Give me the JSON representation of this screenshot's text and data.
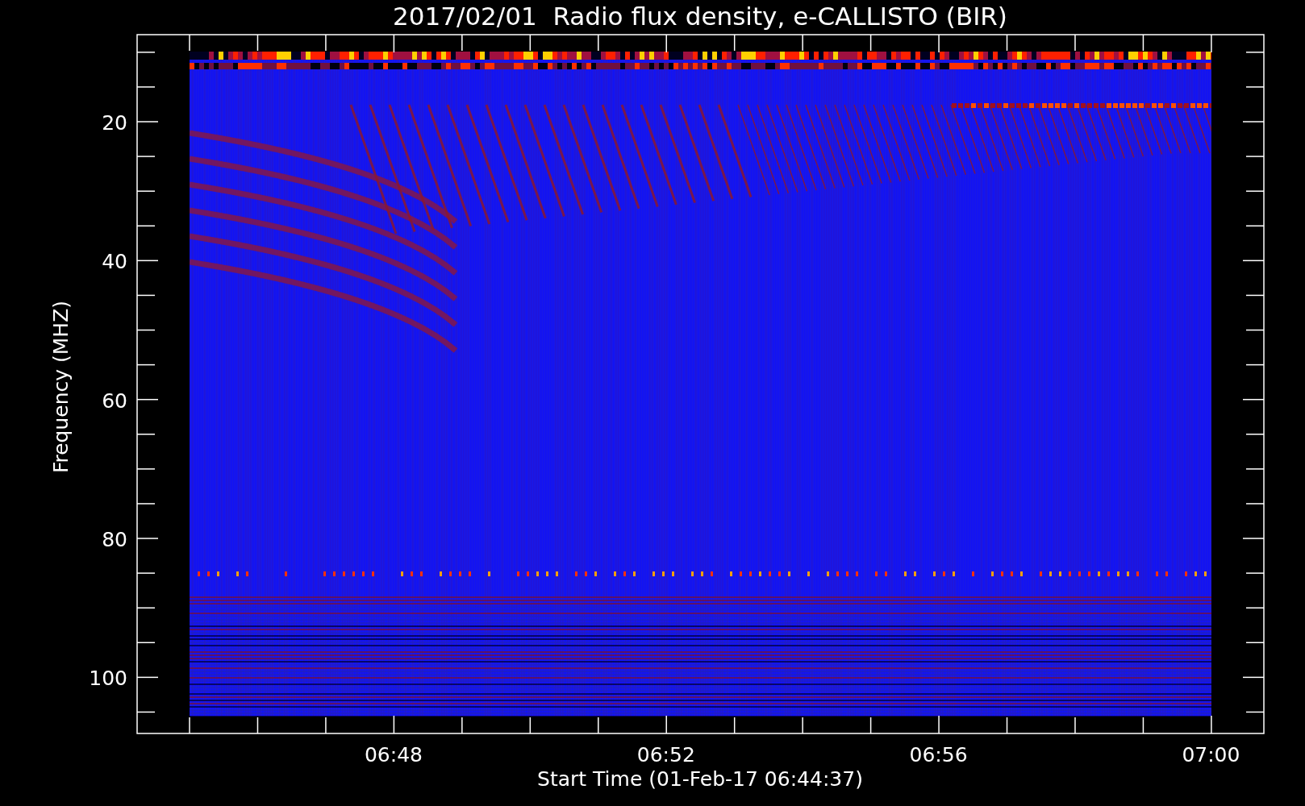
{
  "title": "2017/02/01  Radio flux density, e-CALLISTO (BIR)",
  "ylabel": "Frequency (MHZ)",
  "xlabel": "Start Time (01-Feb-17 06:44:37)",
  "yticks": [
    "20",
    "40",
    "60",
    "80",
    "100"
  ],
  "xticks": [
    "06:48",
    "06:52",
    "06:56",
    "07:00"
  ]
}
